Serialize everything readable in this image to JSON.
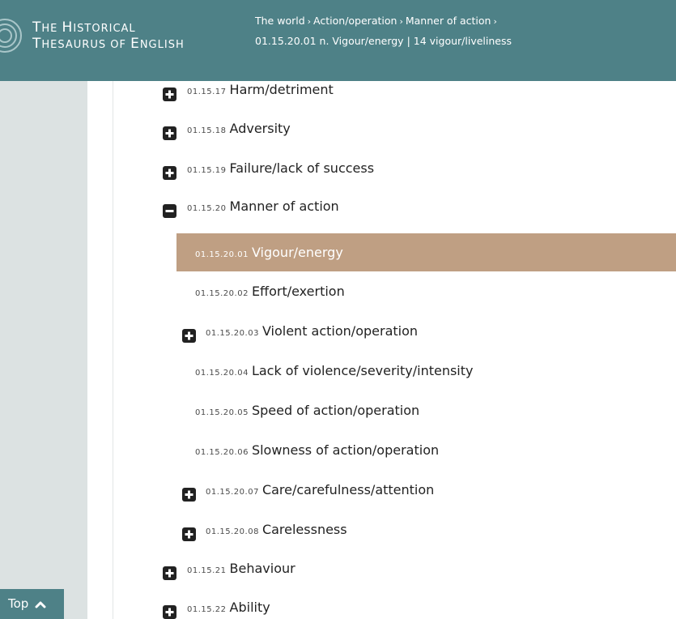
{
  "logo": {
    "line1_first": "T",
    "line1_rest": "HE ",
    "line1_cap": "H",
    "line1_end": "ISTORICAL",
    "line2_first": "T",
    "line2_rest": "HESAURUS OF ",
    "line2_cap": "E",
    "line2_end": "NGLISH"
  },
  "breadcrumb": {
    "line1": [
      {
        "label": "The world"
      },
      {
        "label": "Action/operation"
      },
      {
        "label": "Manner of action"
      }
    ],
    "separator": "›",
    "line2_code": "01.15.20.01 n.",
    "line2_label": "Vigour/energy",
    "line2_divider": "|",
    "line2_sub": "14 vigour/liveliness"
  },
  "colors": {
    "header": "#4e8187",
    "sidebar": "#dce2e2",
    "selected": "#bf9f83"
  },
  "top_button": {
    "label": "Top",
    "icon": "chevron-up-icon"
  },
  "tree": {
    "items": [
      {
        "code": "01.15.17",
        "label": "Harm/detriment",
        "toggle": "plus"
      },
      {
        "code": "01.15.18",
        "label": "Adversity",
        "toggle": "plus"
      },
      {
        "code": "01.15.19",
        "label": "Failure/lack of success",
        "toggle": "plus"
      },
      {
        "code": "01.15.20",
        "label": "Manner of action",
        "toggle": "minus"
      },
      {
        "code": "01.15.20.01",
        "label": "Vigour/energy",
        "toggle": "none",
        "selected": true
      },
      {
        "code": "01.15.20.02",
        "label": "Effort/exertion",
        "toggle": "none"
      },
      {
        "code": "01.15.20.03",
        "label": "Violent action/operation",
        "toggle": "plus"
      },
      {
        "code": "01.15.20.04",
        "label": "Lack of violence/severity/intensity",
        "toggle": "none"
      },
      {
        "code": "01.15.20.05",
        "label": "Speed of action/operation",
        "toggle": "none"
      },
      {
        "code": "01.15.20.06",
        "label": "Slowness of action/operation",
        "toggle": "none"
      },
      {
        "code": "01.15.20.07",
        "label": "Care/carefulness/attention",
        "toggle": "plus"
      },
      {
        "code": "01.15.20.08",
        "label": "Carelessness",
        "toggle": "plus"
      },
      {
        "code": "01.15.21",
        "label": "Behaviour",
        "toggle": "plus"
      },
      {
        "code": "01.15.22",
        "label": "Ability",
        "toggle": "plus"
      }
    ]
  }
}
